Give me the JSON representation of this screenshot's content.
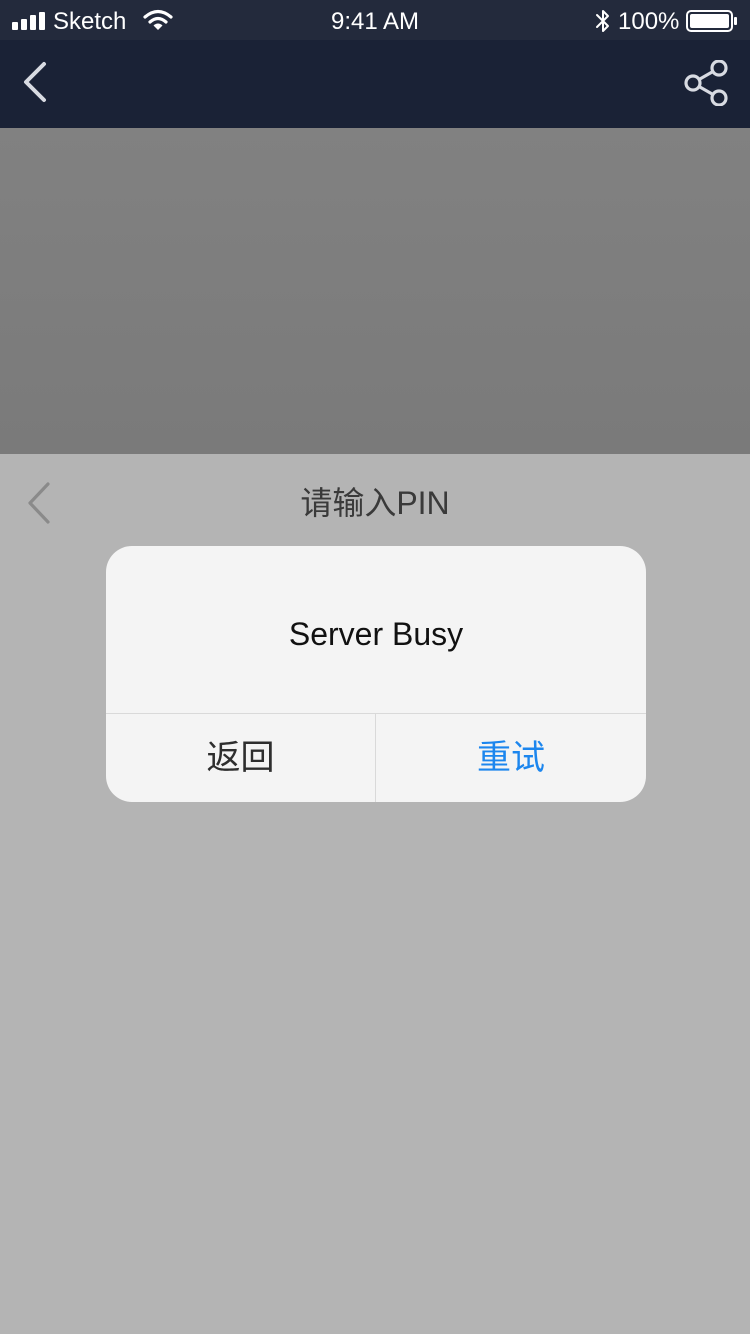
{
  "status_bar": {
    "carrier": "Sketch",
    "time": "9:41 AM",
    "battery": "100%"
  },
  "nav_bar": {
    "icons": [
      "back-icon",
      "share-icon"
    ]
  },
  "pin_sheet": {
    "title": "请输入PIN"
  },
  "alert": {
    "message": "Server Busy",
    "cancel_label": "返回",
    "retry_label": "重试"
  },
  "colors": {
    "nav_background": "#1a2236",
    "accent": "#1c86ee",
    "overlay": "#b4b4b4"
  }
}
